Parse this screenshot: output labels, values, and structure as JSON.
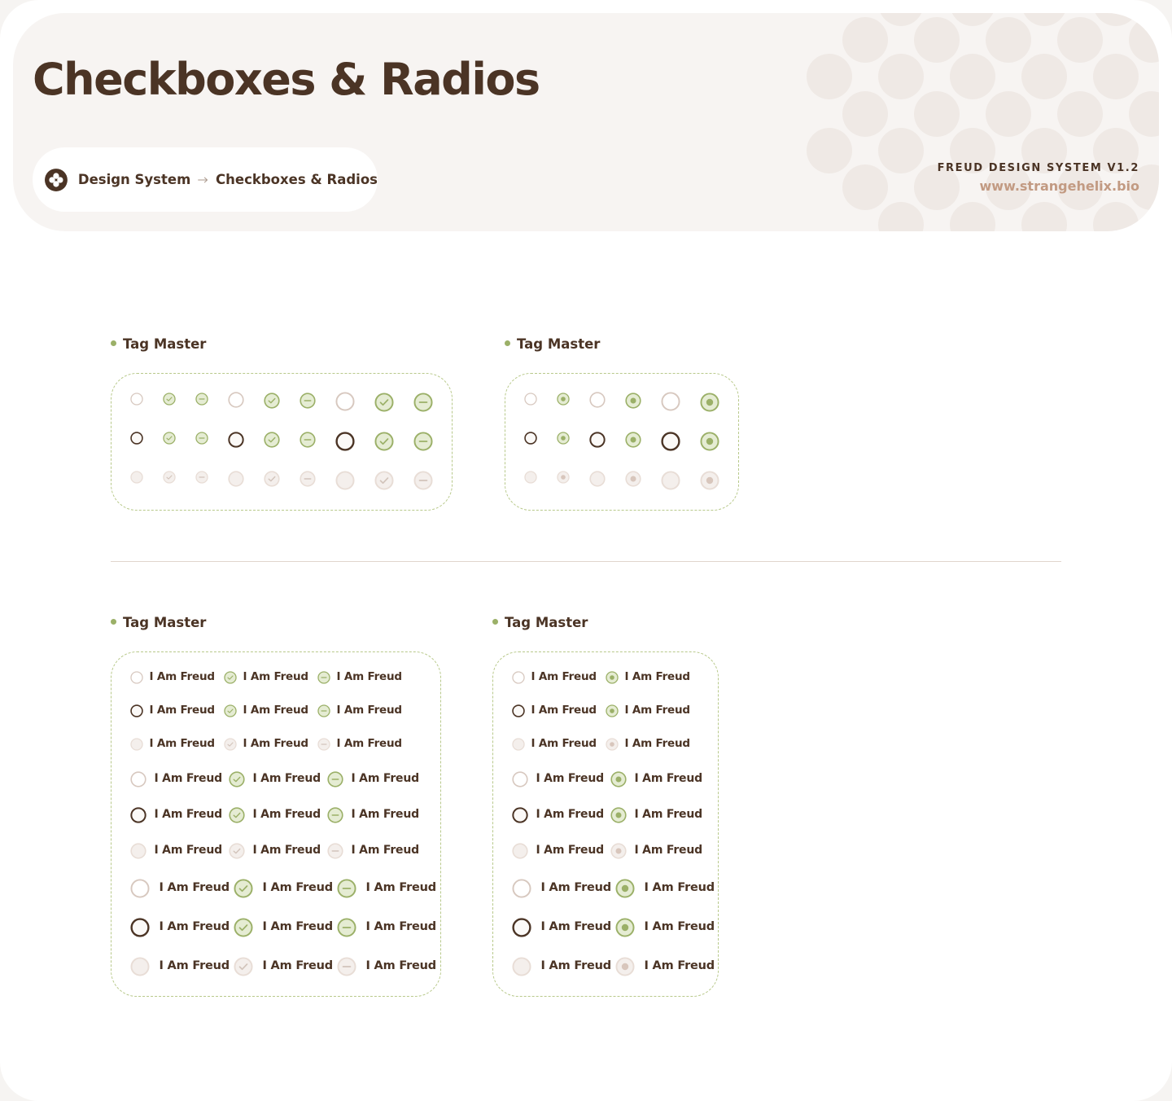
{
  "header": {
    "title": "Checkboxes & Radios",
    "breadcrumb": {
      "root": "Design System",
      "current": "Checkboxes & Radios"
    },
    "brand": {
      "name": "FREUD DESIGN SYSTEM V1.2",
      "url": "www.strangehelix.bio"
    }
  },
  "colors": {
    "brown": "#4b3425",
    "green": "#9bb068",
    "green_fill": "#e5ecd3",
    "muted_fill": "#f4efec",
    "muted_stroke": "#e8ddd6",
    "accent_url": "#c29a82",
    "dashed_border": "#b8c98b"
  },
  "icons": {
    "logo": "freud-logo-icon",
    "breadcrumb_separator": "arrow-right-icon",
    "checkbox_states": [
      "unchecked",
      "checked",
      "indeterminate"
    ],
    "radio_states": [
      "unselected",
      "selected"
    ],
    "row_states": [
      "default",
      "focused",
      "disabled"
    ],
    "sizes": [
      "sm",
      "md",
      "lg"
    ]
  },
  "sections": {
    "checkbox_grid": {
      "title": "Tag Master"
    },
    "radio_grid": {
      "title": "Tag Master"
    },
    "checkbox_list": {
      "title": "Tag Master",
      "item_label": "I Am Freud"
    },
    "radio_list": {
      "title": "Tag Master",
      "item_label": "I Am Freud"
    }
  }
}
